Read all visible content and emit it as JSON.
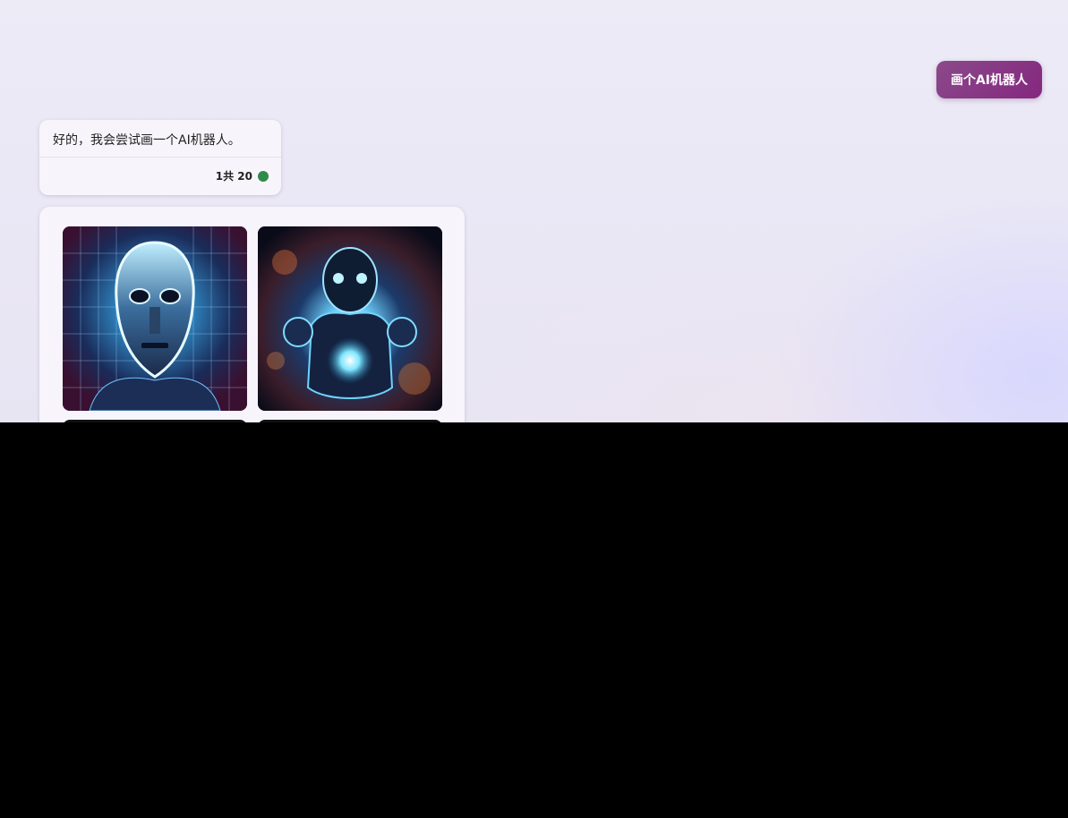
{
  "conversation": {
    "user_message": "画个AI机器人",
    "bot_reply": "好的，我会尝试画一个AI机器人。",
    "bot_counter": "1共 20",
    "status_color": "#2f8a4b"
  },
  "images": {
    "count_visible": 2,
    "items": [
      {
        "name": "generated-image-1"
      },
      {
        "name": "generated-image-2"
      }
    ]
  },
  "colors": {
    "user_bubble": "#85277f",
    "card_background": "#f7f5fb",
    "page_background": "#ecebf6"
  }
}
